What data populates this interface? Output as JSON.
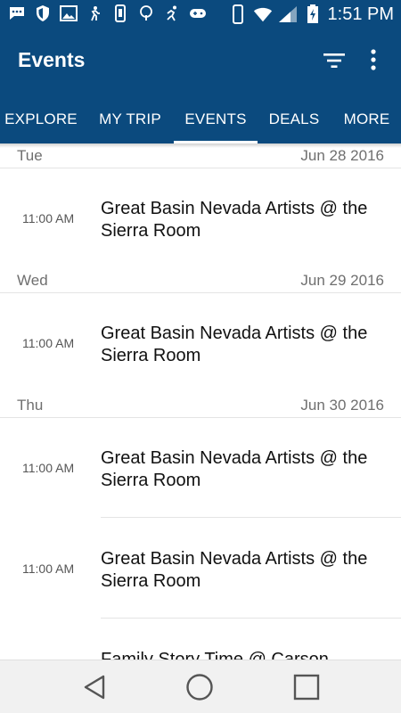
{
  "status_bar": {
    "time": "1:51 PM",
    "icons": [
      "message-icon",
      "shield-icon",
      "image-icon",
      "walk-icon",
      "tag-icon",
      "tree-icon",
      "run-icon",
      "gamepad-icon",
      "phone-vibrate-icon",
      "wifi-icon",
      "signal-icon",
      "battery-charging-icon"
    ]
  },
  "app_bar": {
    "title": "Events",
    "actions": [
      "filter-icon",
      "more-vert-icon"
    ]
  },
  "tabs": [
    {
      "label": "EXPLORE",
      "selected": false
    },
    {
      "label": "MY TRIP",
      "selected": false
    },
    {
      "label": "EVENTS",
      "selected": true
    },
    {
      "label": "DEALS",
      "selected": false
    },
    {
      "label": "MORE",
      "selected": false
    }
  ],
  "days": [
    {
      "day": "Tue",
      "date": "Jun 28 2016",
      "events": [
        {
          "time": "11:00 AM",
          "title": "Great Basin Nevada Artists @ the Sierra Room"
        }
      ]
    },
    {
      "day": "Wed",
      "date": "Jun 29 2016",
      "events": [
        {
          "time": "11:00 AM",
          "title": "Great Basin Nevada Artists @ the Sierra Room"
        }
      ]
    },
    {
      "day": "Thu",
      "date": "Jun 30 2016",
      "events": [
        {
          "time": "11:00 AM",
          "title": "Great Basin Nevada Artists @ the Sierra Room"
        },
        {
          "time": "11:00 AM",
          "title": "Great Basin Nevada Artists @ the Sierra Room"
        },
        {
          "time": "",
          "title": "Family Story Time @ Carson"
        }
      ]
    }
  ],
  "nav_bar": [
    "back-icon",
    "home-icon",
    "recents-icon"
  ]
}
